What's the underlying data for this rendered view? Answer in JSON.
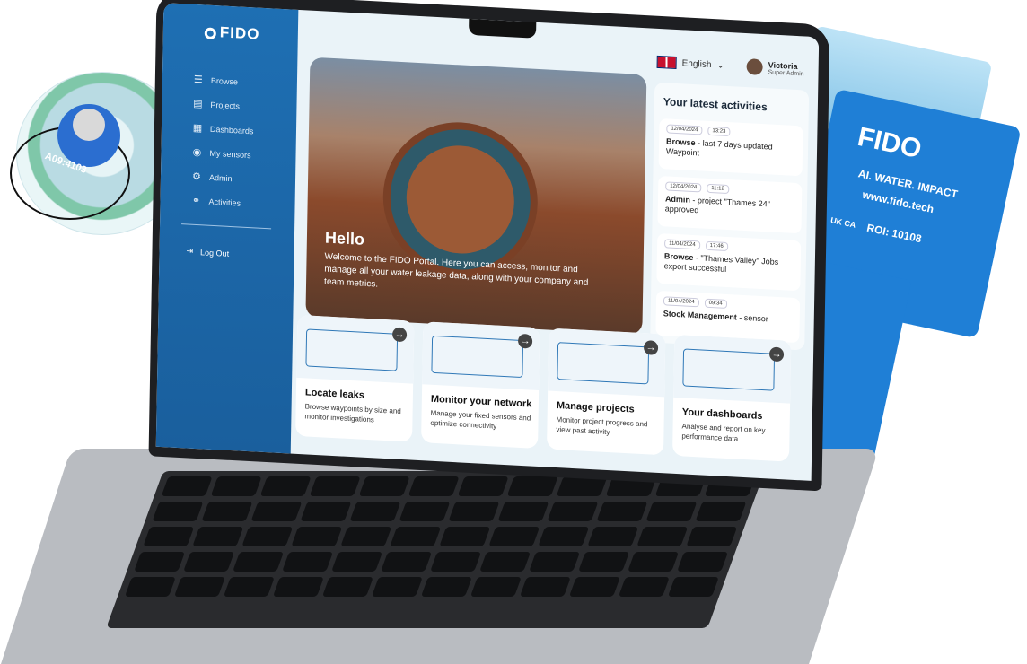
{
  "sidebar": {
    "logo": "FIDO",
    "items": [
      {
        "label": "Browse",
        "icon": "list-icon"
      },
      {
        "label": "Projects",
        "icon": "document-icon"
      },
      {
        "label": "Dashboards",
        "icon": "grid-icon"
      },
      {
        "label": "My sensors",
        "icon": "sensor-icon"
      },
      {
        "label": "Admin",
        "icon": "gear-icon"
      },
      {
        "label": "Activities",
        "icon": "activity-icon"
      }
    ],
    "logout": "Log Out"
  },
  "header": {
    "language": "English",
    "user_name": "Victoria",
    "user_role": "Super Admin"
  },
  "hero": {
    "title": "Hello",
    "text": "Welcome to the FIDO Portal. Here you can access, monitor and manage all your water leakage data, along with your company and team metrics."
  },
  "activities": {
    "title": "Your latest activities",
    "items": [
      {
        "date": "12/04/2024",
        "time": "13:23",
        "bold": "Browse",
        "text": " - last 7 days updated Waypoint"
      },
      {
        "date": "12/04/2024",
        "time": "11:12",
        "bold": "Admin",
        "text": " - project \"Thames 24\" approved"
      },
      {
        "date": "11/04/2024",
        "time": "17:46",
        "bold": "Browse",
        "text": " - \"Thames Valley\" Jobs export successful"
      },
      {
        "date": "11/04/2024",
        "time": "09:34",
        "bold": "Stock Management",
        "text": " - sensor"
      }
    ]
  },
  "cards": [
    {
      "title": "Locate leaks",
      "desc": "Browse waypoints by size and monitor investigations"
    },
    {
      "title": "Monitor your network",
      "desc": "Manage your fixed sensors and optimize connectivity"
    },
    {
      "title": "Manage projects",
      "desc": "Monitor project progress and view past activity"
    },
    {
      "title": "Your dashboards",
      "desc": "Analyse and report on key performance data"
    }
  ],
  "device_puck": {
    "id": "A09:4103",
    "url": "www.fido.tech"
  },
  "device_box": {
    "logo": "FIDO",
    "tagline": "AI. WATER. IMPACT",
    "url": "www.fido.tech",
    "roi": "ROI: 10108",
    "mark": "UK CA"
  }
}
